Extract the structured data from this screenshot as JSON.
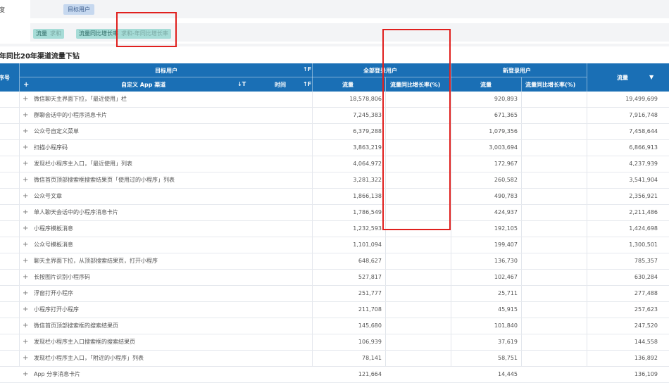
{
  "filters": {
    "row1_label": "度",
    "target_pill": "目标用户",
    "metric_pill_1": {
      "main": "流量",
      "sub": "求和"
    },
    "metric_pill_2": {
      "main": "流量同比增长率",
      "sub": "求和-年同比增长率"
    }
  },
  "report_title": "年同比20年渠道流量下钻",
  "table": {
    "headers": {
      "seq": "序号",
      "target_users": "目标用户",
      "channel": "自定义 App 渠道",
      "time": "时间",
      "all_logged": "全部登录用户",
      "new_logged": "新登录用户",
      "traffic": "流量",
      "growth": "流量同比增长率(%)",
      "traffic_last": "流量",
      "plus": "+"
    },
    "rows": [
      {
        "name": "微信聊天主界面下拉，「最近使用」栏",
        "all": "18,578,806",
        "new": "920,893",
        "total": "19,499,699"
      },
      {
        "name": "群聊会话中的小程序消息卡片",
        "all": "7,245,383",
        "new": "671,365",
        "total": "7,916,748"
      },
      {
        "name": "公众号自定义菜单",
        "all": "6,379,288",
        "new": "1,079,356",
        "total": "7,458,644"
      },
      {
        "name": "扫描小程序码",
        "all": "3,863,219",
        "new": "3,003,694",
        "total": "6,866,913"
      },
      {
        "name": "发现栏小程序主入口，「最近使用」列表",
        "all": "4,064,972",
        "new": "172,967",
        "total": "4,237,939"
      },
      {
        "name": "微信首页顶部搜索框搜索结果页「使用过的小程序」列表",
        "all": "3,281,322",
        "new": "260,582",
        "total": "3,541,904"
      },
      {
        "name": "公众号文章",
        "all": "1,866,138",
        "new": "490,783",
        "total": "2,356,921"
      },
      {
        "name": "单人聊天会话中的小程序消息卡片",
        "all": "1,786,549",
        "new": "424,937",
        "total": "2,211,486"
      },
      {
        "name": "小程序模板消息",
        "all": "1,232,593",
        "new": "192,105",
        "total": "1,424,698"
      },
      {
        "name": "公众号模板消息",
        "all": "1,101,094",
        "new": "199,407",
        "total": "1,300,501"
      },
      {
        "name": "聊天主界面下拉，从顶部搜索结果页，打开小程序",
        "all": "648,627",
        "new": "136,730",
        "total": "785,357"
      },
      {
        "name": "长按图片识别小程序码",
        "all": "527,817",
        "new": "102,467",
        "total": "630,284"
      },
      {
        "name": "浮窗打开小程序",
        "all": "251,777",
        "new": "25,711",
        "total": "277,488"
      },
      {
        "name": "小程序打开小程序",
        "all": "211,708",
        "new": "45,915",
        "total": "257,623"
      },
      {
        "name": "微信首页顶部搜索框的搜索结果页",
        "all": "145,680",
        "new": "101,840",
        "total": "247,520"
      },
      {
        "name": "发现栏小程序主入口搜索框的搜索结果页",
        "all": "106,939",
        "new": "37,619",
        "total": "144,558"
      },
      {
        "name": "发现栏小程序主入口，「附近的小程序」列表",
        "all": "78,141",
        "new": "58,751",
        "total": "136,892"
      },
      {
        "name": "App 分享消息卡片",
        "all": "121,664",
        "new": "14,445",
        "total": "136,109"
      }
    ]
  },
  "icons": {
    "expand": "+",
    "sort": "↓T",
    "sort_alt": "↑F",
    "dropdown": "▼"
  }
}
